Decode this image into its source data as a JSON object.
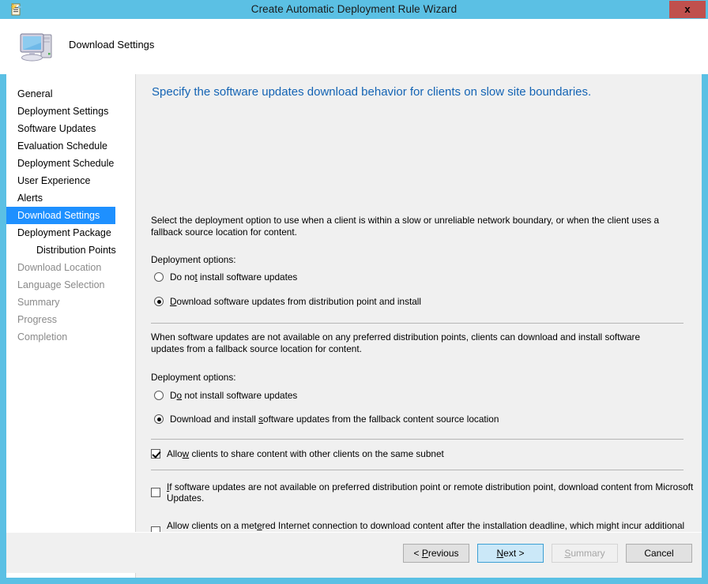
{
  "window": {
    "title": "Create Automatic Deployment Rule Wizard",
    "close_label": "x",
    "titlebar_color": "#5bc0e4",
    "close_color": "#c0504d",
    "icon": "deployment-rule-icon"
  },
  "banner": {
    "title": "Download Settings",
    "icon": "computer-icon"
  },
  "sidebar": {
    "items": [
      {
        "label": "General",
        "state": "normal",
        "sub": false
      },
      {
        "label": "Deployment Settings",
        "state": "normal",
        "sub": false
      },
      {
        "label": "Software Updates",
        "state": "normal",
        "sub": false
      },
      {
        "label": "Evaluation Schedule",
        "state": "normal",
        "sub": false
      },
      {
        "label": "Deployment Schedule",
        "state": "normal",
        "sub": false
      },
      {
        "label": "User Experience",
        "state": "normal",
        "sub": false
      },
      {
        "label": "Alerts",
        "state": "normal",
        "sub": false
      },
      {
        "label": "Download Settings",
        "state": "selected",
        "sub": false
      },
      {
        "label": "Deployment Package",
        "state": "normal",
        "sub": false
      },
      {
        "label": "Distribution Points",
        "state": "normal",
        "sub": true
      },
      {
        "label": "Download Location",
        "state": "disabled",
        "sub": false
      },
      {
        "label": "Language Selection",
        "state": "disabled",
        "sub": false
      },
      {
        "label": "Summary",
        "state": "disabled",
        "sub": false
      },
      {
        "label": "Progress",
        "state": "disabled",
        "sub": false
      },
      {
        "label": "Completion",
        "state": "disabled",
        "sub": false
      }
    ],
    "selected_bg": "#1e90ff"
  },
  "content": {
    "heading": "Specify the software updates download behavior for clients on slow site boundaries.",
    "heading_color": "#1464b4",
    "paragraph_1": "Select the deployment option to use when a client is within a slow or unreliable network boundary, or when the client uses a fallback source location for content.",
    "paragraph_2": "When software updates are not available on any preferred distribution points, clients can download and install software updates from a fallback source location for content.",
    "group_label_1": "Deployment options:",
    "group_label_2": "Deployment options:",
    "radio_1": {
      "label": "Do not install software updates",
      "checked": false,
      "accel": "t",
      "accel_index": 5
    },
    "radio_2": {
      "label": "Download software updates from distribution point and install",
      "checked": true,
      "accel": "D",
      "accel_index": 0
    },
    "radio_3": {
      "label": "Do not install software updates",
      "checked": false,
      "accel": "o",
      "accel_index": 1
    },
    "radio_4": {
      "label": "Download and install software updates from the fallback content source location",
      "checked": true,
      "accel": "e",
      "accel_index": 21
    },
    "checkbox_1": {
      "label": "Allow clients to share content with other clients on the same subnet",
      "checked": true,
      "accel": "w",
      "accel_index": 4
    },
    "checkbox_2": {
      "label": "If software updates are not available on preferred distribution point or remote distribution point, download content from Microsoft Updates.",
      "checked": false,
      "accel": "I",
      "accel_index": 0
    },
    "checkbox_3": {
      "label": "Allow clients on a metered Internet connection to download content after the installation deadline, which might incur additional costs",
      "checked": false,
      "accel": "m",
      "accel_index": 22
    }
  },
  "footer": {
    "buttons": [
      {
        "label": "< Previous",
        "state": "normal",
        "accel_index": 2
      },
      {
        "label": "Next >",
        "state": "default",
        "accel_index": 0
      },
      {
        "label": "Summary",
        "state": "disabled",
        "accel_index": 0
      },
      {
        "label": "Cancel",
        "state": "normal",
        "accel_index": -1
      }
    ]
  }
}
